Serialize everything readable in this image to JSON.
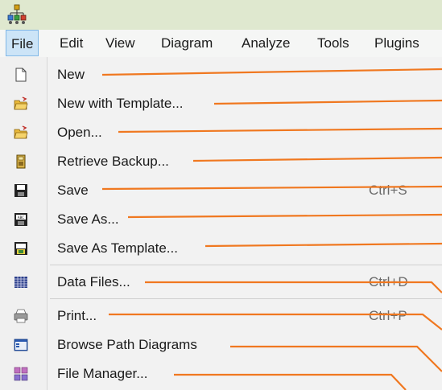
{
  "menubar": {
    "items": [
      {
        "label": "File",
        "active": true
      },
      {
        "label": "Edit"
      },
      {
        "label": "View"
      },
      {
        "label": "Diagram"
      },
      {
        "label": "Analyze"
      },
      {
        "label": "Tools"
      },
      {
        "label": "Plugins"
      }
    ]
  },
  "file_menu": {
    "items": [
      {
        "label": "New",
        "icon": "new-document-icon",
        "shortcut": ""
      },
      {
        "label": "New with Template...",
        "icon": "folder-open-icon",
        "shortcut": ""
      },
      {
        "label": "Open...",
        "icon": "folder-open-icon",
        "shortcut": ""
      },
      {
        "label": "Retrieve Backup...",
        "icon": "backup-icon",
        "shortcut": ""
      },
      {
        "label": "Save",
        "icon": "floppy-disk-icon",
        "shortcut": "Ctrl+S"
      },
      {
        "label": "Save As...",
        "icon": "save-as-icon",
        "shortcut": ""
      },
      {
        "label": "Save As  Template...",
        "icon": "save-as-template-icon",
        "shortcut": ""
      },
      {
        "label": "Data Files...",
        "icon": "data-grid-icon",
        "shortcut": "Ctrl+D"
      },
      {
        "label": "Print...",
        "icon": "printer-icon",
        "shortcut": "Ctrl+P"
      },
      {
        "label": "Browse Path Diagrams",
        "icon": "browse-window-icon",
        "shortcut": ""
      },
      {
        "label": "File Manager...",
        "icon": "file-manager-icon",
        "shortcut": ""
      }
    ]
  },
  "colors": {
    "annotation_line": "#f07820",
    "titlebar": "#dfe8cf",
    "menu_active": "#cce4f7"
  }
}
